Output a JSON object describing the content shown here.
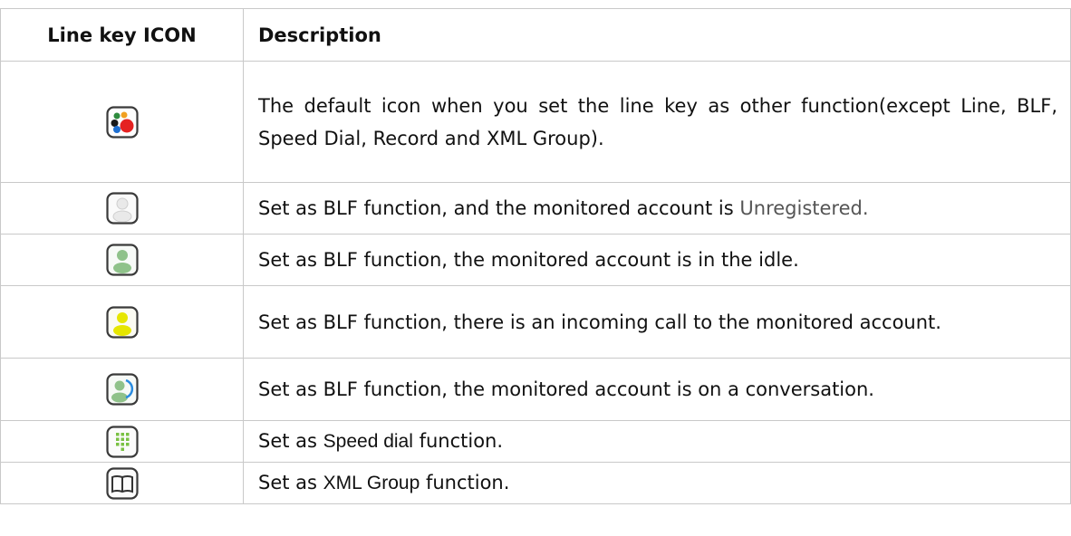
{
  "table": {
    "headers": {
      "icon": "Line key ICON",
      "description": "Description"
    },
    "rows": [
      {
        "icon": "default-function-icon",
        "description": "The default icon when you set the line key as other function(except Line, BLF, Speed Dial, Record and XML Group)."
      },
      {
        "icon": "blf-unregistered-icon",
        "description_prefix": "Set as BLF function, and the monitored account is ",
        "description_highlight": "Unregistered",
        "description_suffix": "."
      },
      {
        "icon": "blf-idle-icon",
        "description": "Set as BLF function, the monitored account is in the idle."
      },
      {
        "icon": "blf-incoming-call-icon",
        "description": "Set as BLF function, there is an incoming call to the monitored account."
      },
      {
        "icon": "blf-conversation-icon",
        "description": "Set as BLF function, the monitored account is on a conversation."
      },
      {
        "icon": "speed-dial-icon",
        "description_prefix": "Set as ",
        "description_alt": "Speed dial",
        "description_suffix": " function."
      },
      {
        "icon": "xml-group-icon",
        "description_prefix": "Set as ",
        "description_alt": "XML Group",
        "description_suffix": " function."
      }
    ]
  },
  "colors": {
    "grid": "#c9c9c9",
    "unregistered_text": "#555555",
    "idle_person": "#8fc28a",
    "incoming_person": "#e6e600",
    "speed_dial_dots": "#7ac143"
  }
}
